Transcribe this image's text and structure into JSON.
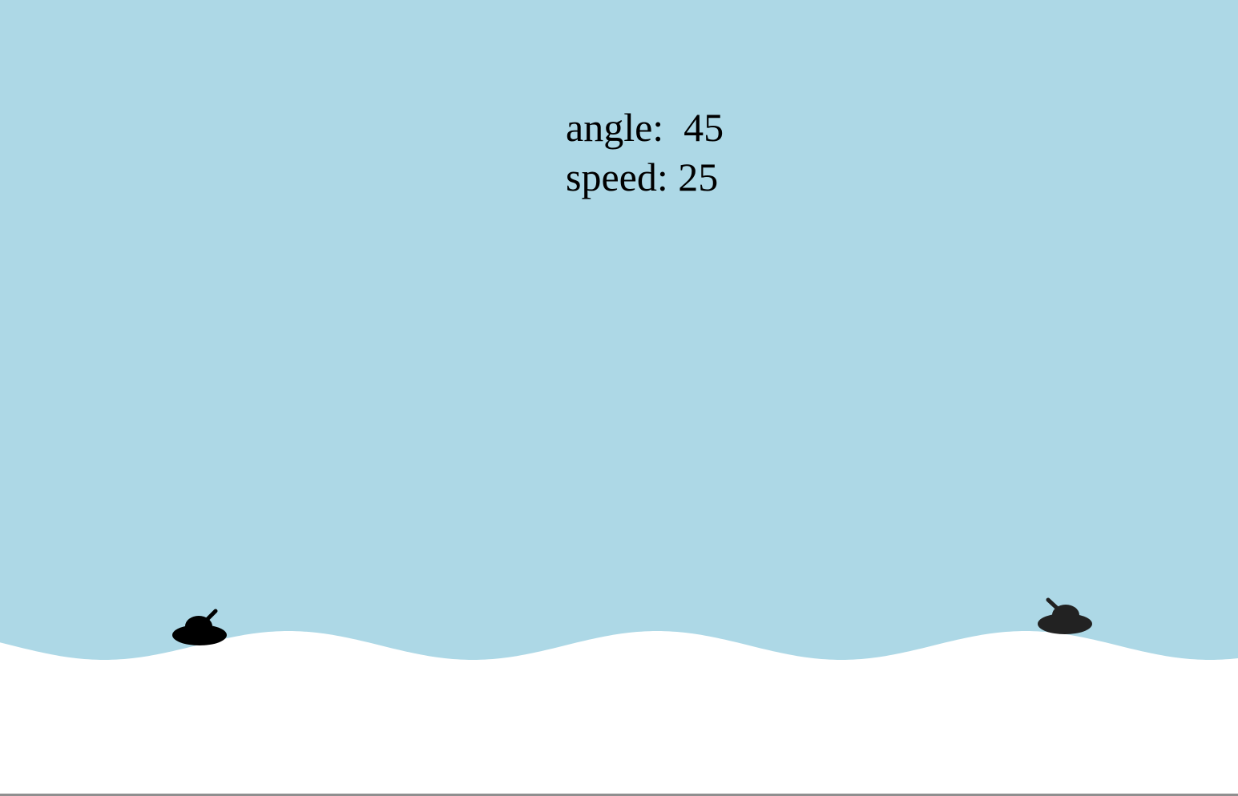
{
  "hud": {
    "angle_label": "angle:",
    "angle_value": "45",
    "speed_label": "speed:",
    "speed_value": "25"
  },
  "colors": {
    "sky": "#add8e6",
    "ground": "#ffffff",
    "player_tank": "#000000",
    "enemy_tank": "#222222",
    "hud_text": "#000000"
  },
  "icons": {
    "player": "tank-icon",
    "enemy": "tank-icon"
  }
}
